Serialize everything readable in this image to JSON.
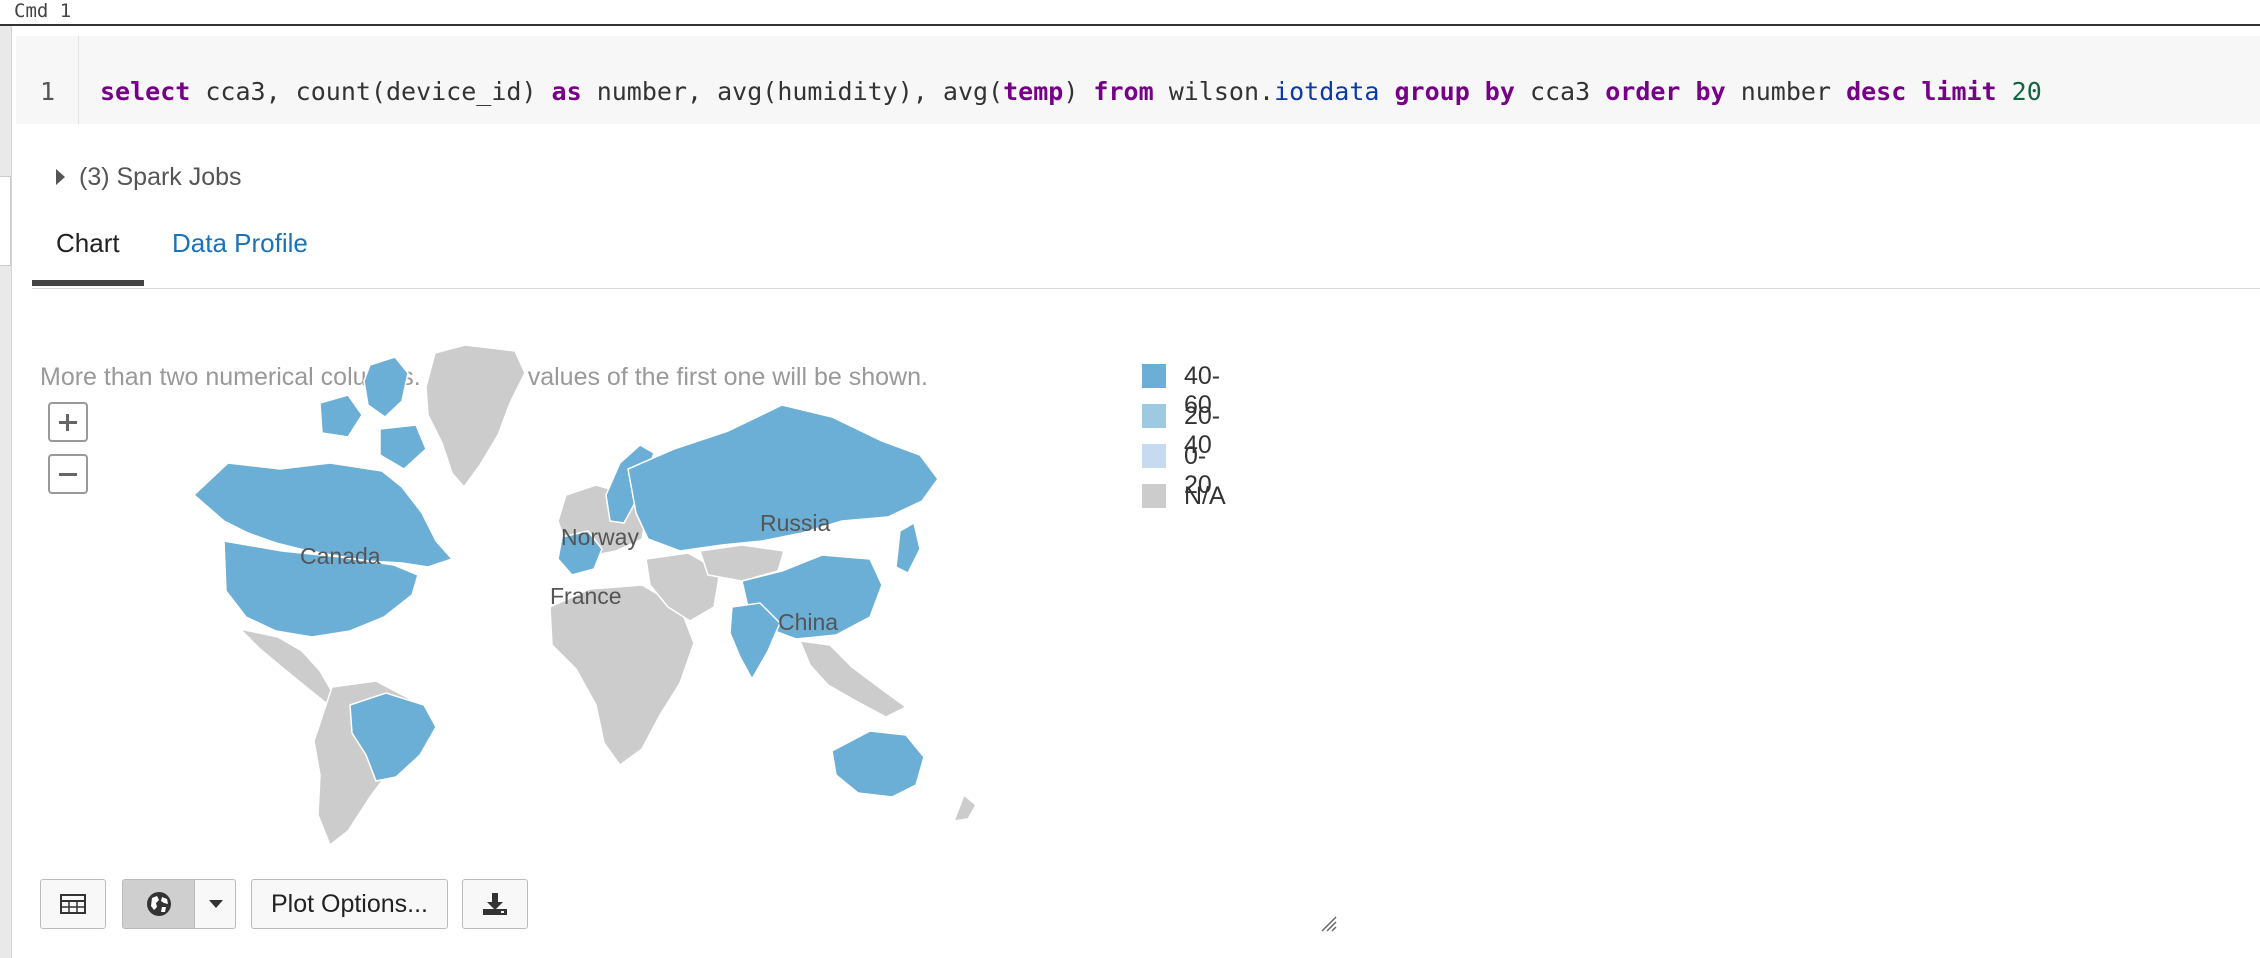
{
  "cell": {
    "title": "Cmd 1",
    "line_number": "1",
    "code": {
      "t1": "select",
      "t2": " cca3, count(device_id) ",
      "t3": "as",
      "t4": " number, avg(humidity), avg(",
      "t5": "temp",
      "t6": ") ",
      "t7": "from",
      "t8": " wilson.",
      "t9": "iotdata",
      "t10": " ",
      "t11": "group by",
      "t12": " cca3 ",
      "t13": "order by",
      "t14": " number ",
      "t15": "desc",
      "t16": " ",
      "t17": "limit",
      "t18": " ",
      "t19": "20"
    }
  },
  "spark_jobs": {
    "label": "(3) Spark Jobs"
  },
  "tabs": [
    {
      "label": "Chart",
      "active": true
    },
    {
      "label": "Data Profile",
      "active": false
    }
  ],
  "chart": {
    "notice": "More than two numerical columns. Only the values of the first one will be shown.",
    "map_labels": {
      "canada": "Canada",
      "norway": "Norway",
      "france": "France",
      "russia": "Russia",
      "china": "China"
    },
    "legend": [
      {
        "label": "40-60",
        "color": "#6baed6"
      },
      {
        "label": "20-40",
        "color": "#9ecae1"
      },
      {
        "label": "0-20",
        "color": "#c6dbef"
      },
      {
        "label": "N/A",
        "color": "#cccccc"
      }
    ]
  },
  "toolbar": {
    "plot_options": "Plot Options..."
  },
  "icons": [
    "caret-right-icon",
    "plus-icon",
    "minus-icon",
    "table-icon",
    "globe-icon",
    "chevron-down-icon",
    "download-icon",
    "resize-handle-icon"
  ]
}
